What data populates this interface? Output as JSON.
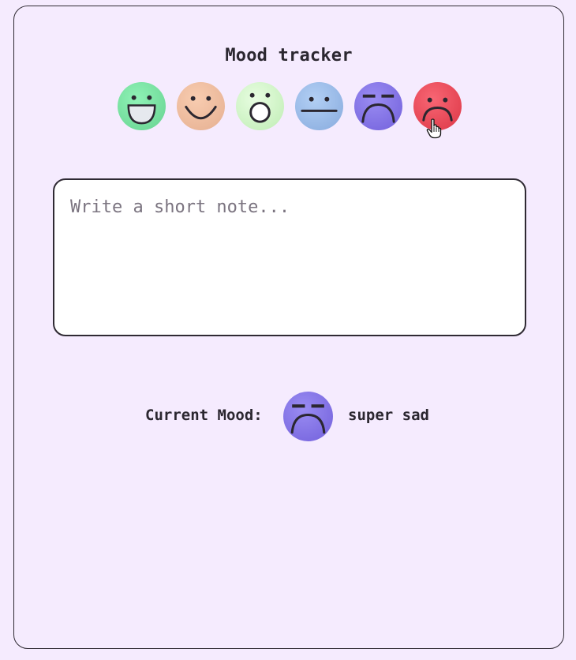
{
  "app": {
    "title": "Mood tracker"
  },
  "moods": [
    {
      "name": "super happy",
      "icon": "super-happy-face-icon",
      "color": "#7fe8a8"
    },
    {
      "name": "happy",
      "icon": "happy-face-icon",
      "color": "#f3c4a6"
    },
    {
      "name": "surprised",
      "icon": "surprised-face-icon",
      "color": "#d8f7cf"
    },
    {
      "name": "neutral",
      "icon": "neutral-face-icon",
      "color": "#a5c3ee"
    },
    {
      "name": "super sad",
      "icon": "super-sad-face-icon",
      "color": "#8576e8"
    },
    {
      "name": "sad",
      "icon": "sad-face-icon",
      "color": "#f0505f"
    }
  ],
  "note": {
    "placeholder": "Write a short note...",
    "value": ""
  },
  "current": {
    "label": "Current Mood:",
    "value": "super sad",
    "icon": "super-sad-face-icon"
  }
}
